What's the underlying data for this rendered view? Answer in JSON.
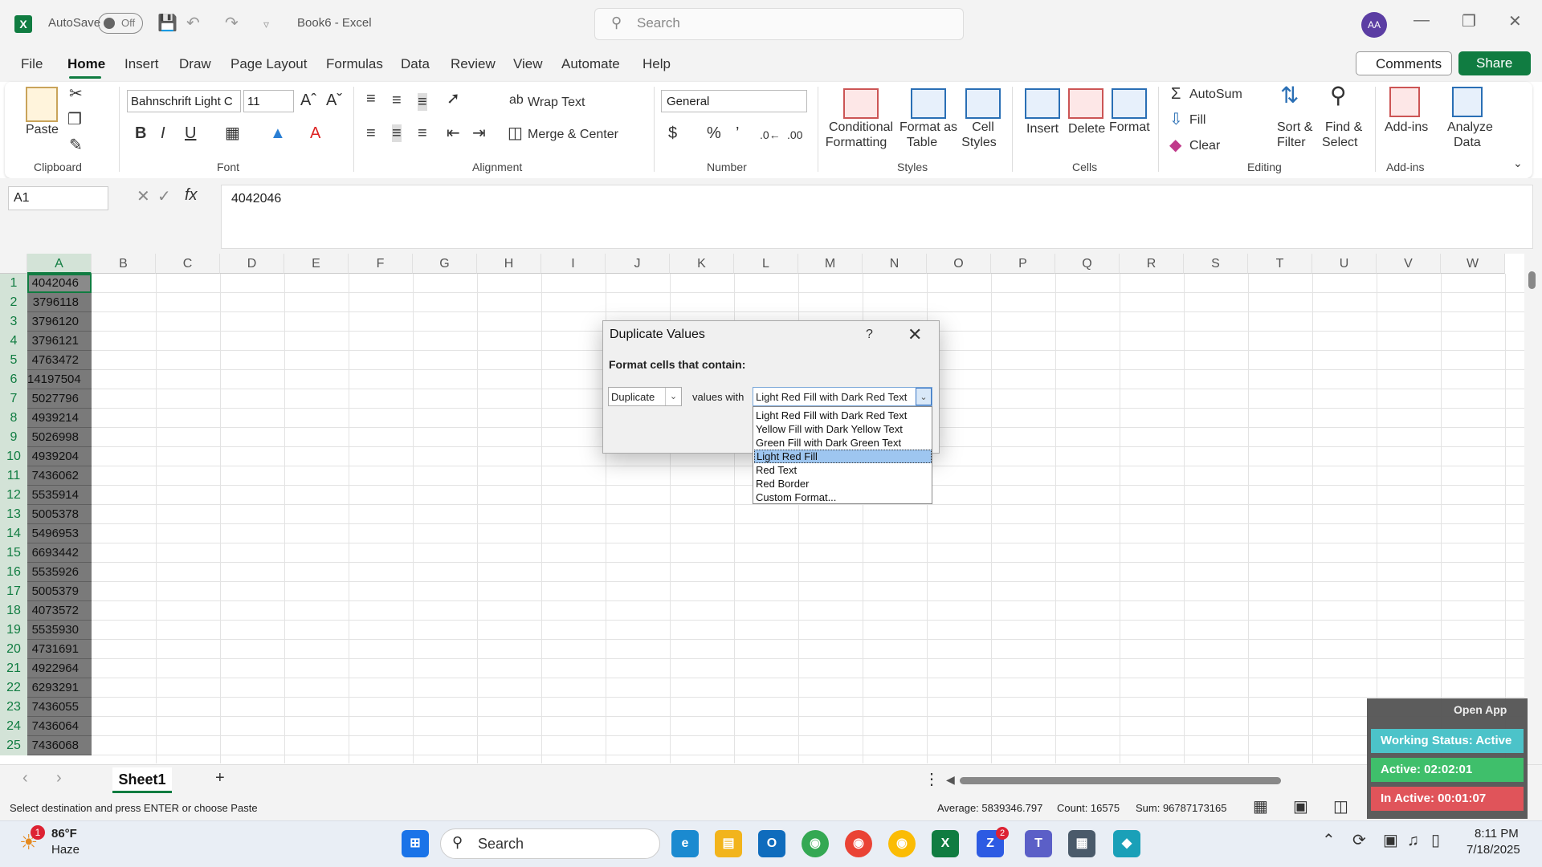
{
  "app": {
    "autosave_label": "AutoSave",
    "autosave_state": "Off",
    "doc_title": "Book6 - Excel",
    "search_placeholder": "Search",
    "avatar_initials": "AA"
  },
  "menu": {
    "tabs": [
      "File",
      "Home",
      "Insert",
      "Draw",
      "Page Layout",
      "Formulas",
      "Data",
      "Review",
      "View",
      "Automate",
      "Help"
    ],
    "comments": "Comments",
    "share": "Share"
  },
  "ribbon": {
    "paste": "Paste",
    "font_name": "Bahnschrift Light C",
    "font_size": "11",
    "wrap_text": "Wrap Text",
    "merge_center": "Merge & Center",
    "number_format": "General",
    "conditional_formatting": [
      "Conditional",
      "Formatting"
    ],
    "format_as_table": [
      "Format as",
      "Table"
    ],
    "cell_styles": [
      "Cell",
      "Styles"
    ],
    "insert": "Insert",
    "delete": "Delete",
    "format": "Format",
    "autosum": "AutoSum",
    "fill": "Fill",
    "clear": "Clear",
    "sort_filter": [
      "Sort &",
      "Filter"
    ],
    "find_select": [
      "Find &",
      "Select"
    ],
    "addins": "Add-ins",
    "analyze_data": [
      "Analyze",
      "Data"
    ],
    "groups": {
      "clipboard": "Clipboard",
      "font": "Font",
      "alignment": "Alignment",
      "number": "Number",
      "styles": "Styles",
      "cells": "Cells",
      "editing": "Editing",
      "addins": "Add-ins"
    }
  },
  "formula_bar": {
    "name_box": "A1",
    "formula": "4042046"
  },
  "columns": [
    "A",
    "B",
    "C",
    "D",
    "E",
    "F",
    "G",
    "H",
    "I",
    "J",
    "K",
    "L",
    "M",
    "N",
    "O",
    "P",
    "Q",
    "R",
    "S",
    "T",
    "U",
    "V",
    "W"
  ],
  "rows": [
    {
      "n": "1",
      "a": "4042046"
    },
    {
      "n": "2",
      "a": "3796118"
    },
    {
      "n": "3",
      "a": "3796120"
    },
    {
      "n": "4",
      "a": "3796121"
    },
    {
      "n": "5",
      "a": "4763472"
    },
    {
      "n": "6",
      "a": "14197504"
    },
    {
      "n": "7",
      "a": "5027796"
    },
    {
      "n": "8",
      "a": "4939214"
    },
    {
      "n": "9",
      "a": "5026998"
    },
    {
      "n": "10",
      "a": "4939204"
    },
    {
      "n": "11",
      "a": "7436062"
    },
    {
      "n": "12",
      "a": "5535914"
    },
    {
      "n": "13",
      "a": "5005378"
    },
    {
      "n": "14",
      "a": "5496953"
    },
    {
      "n": "15",
      "a": "6693442"
    },
    {
      "n": "16",
      "a": "5535926"
    },
    {
      "n": "17",
      "a": "5005379"
    },
    {
      "n": "18",
      "a": "4073572"
    },
    {
      "n": "19",
      "a": "5535930"
    },
    {
      "n": "20",
      "a": "4731691"
    },
    {
      "n": "21",
      "a": "4922964"
    },
    {
      "n": "22",
      "a": "6293291"
    },
    {
      "n": "23",
      "a": "7436055"
    },
    {
      "n": "24",
      "a": "7436064"
    },
    {
      "n": "25",
      "a": "7436068"
    }
  ],
  "dialog": {
    "title": "Duplicate Values",
    "help": "?",
    "label": "Format cells that contain:",
    "type_value": "Duplicate",
    "values_with": "values with",
    "format_value": "Light Red Fill with Dark Red Text",
    "options": [
      "Light Red Fill with Dark Red Text",
      "Yellow Fill with Dark Yellow Text",
      "Green Fill with Dark Green Text",
      "Light Red Fill",
      "Red Text",
      "Red Border",
      "Custom Format..."
    ],
    "highlighted_option": "Light Red Fill"
  },
  "sheet": {
    "tab": "Sheet1"
  },
  "status": {
    "message": "Select destination and press ENTER or choose Paste",
    "average": "Average: 5839346.797",
    "count": "Count: 16575",
    "sum": "Sum: 96787173165"
  },
  "widget": {
    "open_app": "Open App",
    "working_status": "Working Status: Active",
    "active": "Active: 02:02:01",
    "inactive": "In Active: 00:01:07"
  },
  "taskbar": {
    "temperature": "86°F",
    "weather": "Haze",
    "search": "Search",
    "time": "8:11 PM",
    "date": "7/18/2025",
    "weather_badge": "1",
    "zoom_badge": "2"
  },
  "colors": {
    "excel_green": "#107c41",
    "selection_gray": "#7a7a7a",
    "active_green": "#3fbf6b",
    "inactive_red": "#e0545a",
    "working_teal": "#4cc3c9"
  }
}
